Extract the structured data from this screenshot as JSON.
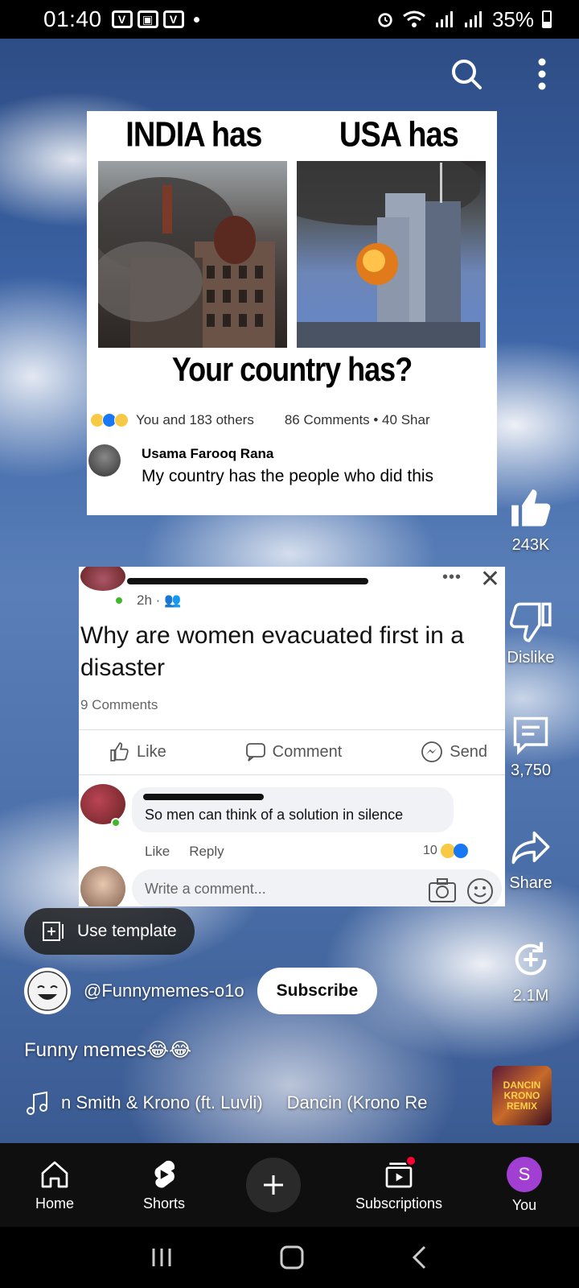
{
  "status_bar": {
    "time": "01:40",
    "app_icons": [
      "V",
      "▣",
      "V"
    ],
    "battery": "35%"
  },
  "meme1": {
    "left_heading": "INDIA has",
    "right_heading": "USA has",
    "question": "Your country has?",
    "reactions_text": "You and 183 others",
    "stats_text": "86 Comments • 40 Shar",
    "commenter_name": "Usama Farooq Rana",
    "comment_text": "My country has the people who did this"
  },
  "meme2": {
    "time": "2h ·",
    "post_text": "Why are women evacuated first in a disaster",
    "comment_count": "9 Comments",
    "actions": {
      "like": "Like",
      "comment": "Comment",
      "send": "Send"
    },
    "reply_text": "So men can think of a solution in silence",
    "reply_like": "Like",
    "reply_reply": "Reply",
    "reply_reactions": "10",
    "write_placeholder": "Write a comment..."
  },
  "rail": {
    "likes": "243K",
    "dislike": "Dislike",
    "comments": "3,750",
    "share": "Share",
    "remix": "2.1M"
  },
  "overlay": {
    "use_template": "Use template",
    "channel": "@Funnymemes-o1o",
    "subscribe": "Subscribe",
    "caption": "Funny memes😂😂",
    "music_artist": "n Smith & Krono (ft. Luvli)",
    "music_title": "Dancin (Krono Re",
    "music_thumb_text": "DANCIN KRONO REMIX"
  },
  "nav": {
    "home": "Home",
    "shorts": "Shorts",
    "subscriptions": "Subscriptions",
    "you": "You",
    "you_initial": "S"
  },
  "colors": {
    "nav_bg": "#0f0f0f",
    "you_avatar": "#a13fd3",
    "notif": "#ff0033"
  }
}
